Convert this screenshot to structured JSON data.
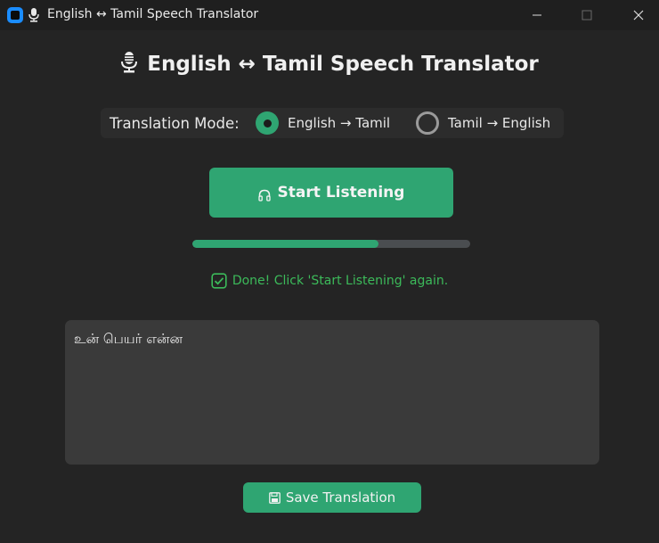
{
  "window": {
    "title": "English ↔ Tamil Speech Translator"
  },
  "header": {
    "title": "English ↔ Tamil Speech Translator"
  },
  "mode": {
    "label": "Translation Mode:",
    "options": [
      {
        "label": "English → Tamil",
        "selected": true
      },
      {
        "label": "Tamil → English",
        "selected": false
      }
    ]
  },
  "start_button": {
    "label": "Start Listening"
  },
  "progress": {
    "value": 0.67
  },
  "status": {
    "text": "Done! Click 'Start Listening' again."
  },
  "output": {
    "text": "உன் பெயர் என்ன"
  },
  "save_button": {
    "label": "Save Translation"
  },
  "colors": {
    "accent": "#2fa572",
    "background": "#242424",
    "status": "#3cba5a"
  },
  "icons": [
    "app-icon",
    "microphone-icon",
    "headphones-icon",
    "checkbox-icon",
    "floppy-disk-icon"
  ]
}
